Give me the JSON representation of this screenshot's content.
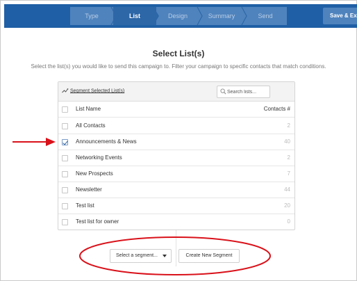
{
  "wizard": {
    "steps": [
      {
        "label": "Type",
        "active": false
      },
      {
        "label": "List",
        "active": true
      },
      {
        "label": "Design",
        "active": false
      },
      {
        "label": "Summary",
        "active": false
      },
      {
        "label": "Send",
        "active": false
      }
    ],
    "save_exit_label": "Save & Exit"
  },
  "page": {
    "title": "Select List(s)",
    "subtitle": "Select the list(s) you would like to send this campaign to. Filter your campaign to specific contacts that match conditions."
  },
  "toolbar": {
    "segment_link": "Segment Selected List(s)",
    "search_placeholder": "Search lists..."
  },
  "table": {
    "headers": {
      "name": "List Name",
      "count": "Contacts #"
    },
    "rows": [
      {
        "name": "All Contacts",
        "count": "2",
        "checked": false
      },
      {
        "name": "Announcements & News",
        "count": "40",
        "checked": true
      },
      {
        "name": "Networking Events",
        "count": "2",
        "checked": false
      },
      {
        "name": "New Prospects",
        "count": "7",
        "checked": false
      },
      {
        "name": "Newsletter",
        "count": "44",
        "checked": false
      },
      {
        "name": "Test list",
        "count": "20",
        "checked": false
      },
      {
        "name": "Test list for owner",
        "count": "0",
        "checked": false
      }
    ]
  },
  "actions": {
    "select_segment_label": "Select a segment...",
    "create_segment_label": "Create New Segment"
  },
  "colors": {
    "topbar": "#1f5fa5",
    "steps_bg": "#4f83bd",
    "annotation_red": "#d9111a",
    "checkbox_check": "#2a5f9e"
  }
}
